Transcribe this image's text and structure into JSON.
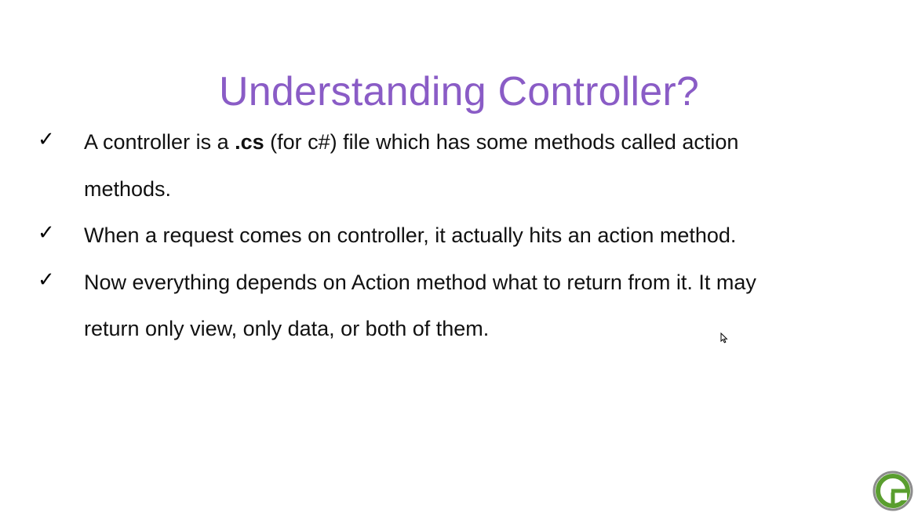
{
  "slide": {
    "title": "Understanding Controller?",
    "bullets": [
      {
        "pre": "A controller is a ",
        "bold": ".cs",
        "post": " (for c#) file which has some methods called action methods."
      },
      {
        "text": "When a request comes on controller, it actually hits an action method."
      },
      {
        "text": "Now everything depends on Action method what to return from it. It may return only view, only data, or both of them."
      }
    ],
    "check_icon": "checkmark-icon",
    "logo_icon": "circular-g-logo-icon",
    "colors": {
      "title": "#8a5cc6",
      "logo_green": "#5a9e2f",
      "logo_gray": "#8c8c8c"
    }
  }
}
